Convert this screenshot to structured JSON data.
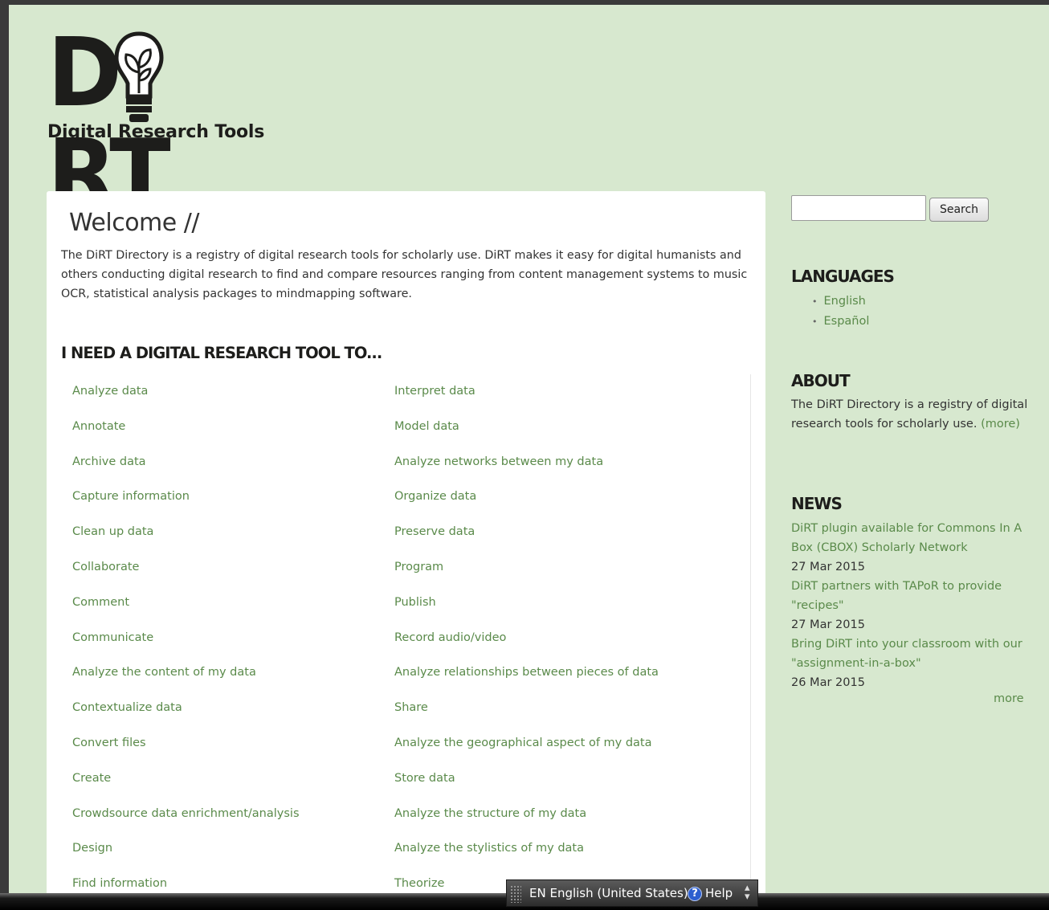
{
  "logo": {
    "letters_left": "D",
    "letters_right": "RT",
    "subtitle": "Digital Research Tools"
  },
  "welcome": {
    "title": "Welcome //",
    "intro": "The DiRT Directory is a registry of digital research tools for scholarly use. DiRT makes it easy for digital humanists and others conducting digital research to find and compare resources ranging from content management systems to music OCR, statistical analysis packages to mindmapping software."
  },
  "tools": {
    "heading": "I NEED A DIGITAL RESEARCH TOOL TO...",
    "left": [
      "Analyze data",
      "Annotate",
      "Archive data",
      "Capture information",
      "Clean up data",
      "Collaborate",
      "Comment",
      "Communicate",
      "Analyze the content of my data",
      "Contextualize data",
      "Convert files",
      "Create",
      "Crowdsource data enrichment/analysis",
      "Design",
      "Find information"
    ],
    "right": [
      "Interpret data",
      "Model data",
      "Analyze networks between my data",
      "Organize data",
      "Preserve data",
      "Program",
      "Publish",
      "Record audio/video",
      "Analyze relationships between pieces of data",
      "Share",
      "Analyze the geographical aspect of my data",
      "Store data",
      "Analyze the structure of my data",
      "Analyze the stylistics of my data",
      "Theorize"
    ]
  },
  "search": {
    "value": "",
    "button_label": "Search"
  },
  "languages": {
    "heading": "LANGUAGES",
    "items": [
      "English",
      "Español"
    ]
  },
  "about": {
    "heading": "ABOUT",
    "text": "The DiRT Directory is a registry of digital research tools for scholarly use.",
    "more": "(more)"
  },
  "news": {
    "heading": "NEWS",
    "items": [
      {
        "title": "DiRT plugin available for Commons In A Box (CBOX) Scholarly Network",
        "date": "27 Mar 2015"
      },
      {
        "title": "DiRT partners with TAPoR to provide \"recipes\"",
        "date": "27 Mar 2015"
      },
      {
        "title": "Bring DiRT into your classroom with our \"assignment-in-a-box\"",
        "date": "26 Mar 2015"
      }
    ],
    "more": "more"
  },
  "language_bar": {
    "language": "EN English (United States)",
    "help": "Help",
    "help_icon": "question-circle-icon"
  },
  "colors": {
    "page_background": "#d7e8cf",
    "link": "#5a8a4a",
    "heading": "#1d1d1b"
  }
}
